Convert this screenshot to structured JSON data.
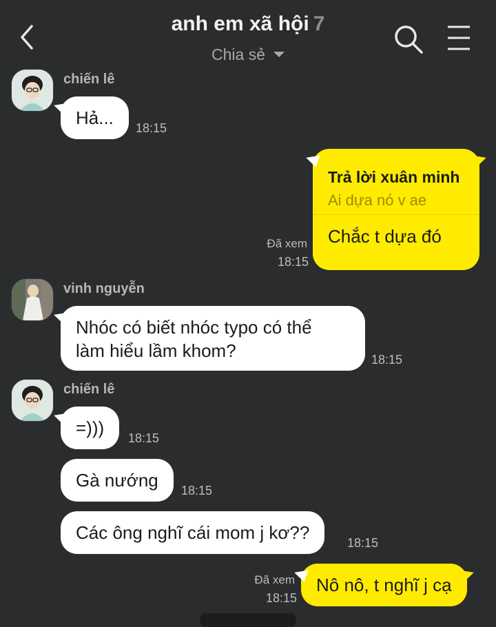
{
  "header": {
    "title": "anh em xã hội",
    "member_count": "7",
    "subtitle": "Chia sẻ"
  },
  "messages": {
    "m1": {
      "sender": "chiến lê",
      "text": "Hả...",
      "time": "18:15"
    },
    "m2": {
      "reply_to": "Trả lời xuân minh",
      "quote": "Ai dựa nó v ae",
      "text": "Chắc t dựa đó",
      "seen": "Đã xem",
      "time": "18:15"
    },
    "m3": {
      "sender": "vinh nguyễn",
      "line1": "Nhóc có biết nhóc typo có thể",
      "line2": "làm hiểu lầm khom?",
      "time": "18:15"
    },
    "m4": {
      "sender": "chiến lê",
      "text": "=)))",
      "time": "18:15"
    },
    "m5": {
      "text": "Gà nướng",
      "time": "18:15"
    },
    "m6": {
      "text": "Các ông nghĩ cái mom j kơ??",
      "time": "18:15"
    },
    "m7": {
      "text": "Nô nô, t nghĩ j cạ",
      "seen": "Đã xem",
      "time": "18:15"
    }
  },
  "icons": {
    "back": "chevron-left-icon",
    "search": "search-icon",
    "menu": "hamburger-menu-icon",
    "dropdown": "caret-down-icon"
  },
  "colors": {
    "background": "#2b2c2e",
    "my_bubble": "#ffeb00",
    "their_bubble": "#ffffff"
  }
}
